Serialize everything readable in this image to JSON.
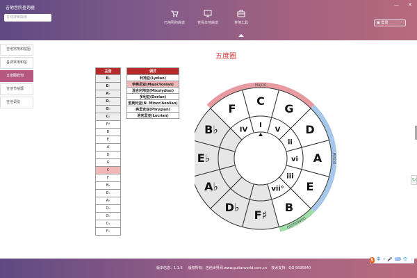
{
  "app": {
    "title": "吉他音阶查询器",
    "version": "版本信息：1.1.6",
    "copyright": "版权所有：吉他世界网 www.guitarworld.com.cn",
    "support": "技术支持：QQ 5695840"
  },
  "search": {
    "placeholder": "在线搜索曲谱"
  },
  "window_controls": {
    "minimize": "—",
    "close": "✕"
  },
  "nav": [
    {
      "label": "已拍照的曲谱",
      "icon": "cart-icon"
    },
    {
      "label": "查看本地曲谱",
      "icon": "monitor-icon"
    },
    {
      "label": "吉他工具",
      "icon": "toolbox-icon",
      "active": true
    }
  ],
  "login": {
    "label": "登录"
  },
  "sidebar": [
    {
      "label": "吉他常用和弦图"
    },
    {
      "label": "各调常用和弦"
    },
    {
      "label": "五度圈查询",
      "active": true
    },
    {
      "label": "吉他节拍器"
    },
    {
      "label": "吉他调弦"
    }
  ],
  "page": {
    "title": "五度圈"
  },
  "key_table": {
    "header": "主音",
    "keys": [
      "B♭",
      "E♭",
      "A♭",
      "D♭",
      "G♭",
      "C♭",
      "F♯",
      "B",
      "E",
      "A",
      "D",
      "G",
      "C",
      "F",
      "B♭",
      "E♭",
      "A♭",
      "D♭",
      "G♭",
      "C♭",
      "F♭"
    ],
    "selected": "C"
  },
  "mode_table": {
    "header": "调式",
    "modes": [
      "利地亚(Lydian)",
      "伊奥尼亚(Major/Ionian)",
      "混合利地亚(Mixolydian)",
      "多利亚(Dorian)",
      "爱奥利亚(N. Minor/Aeolian)",
      "弗里吉亚(Phrygian)",
      "洛克里亚(Locrian)"
    ],
    "selected": "伊奥尼亚(Major/Ionian)"
  },
  "circle": {
    "outer_keys": [
      "C",
      "G",
      "D",
      "A",
      "E",
      "B",
      "F♯",
      "D♭",
      "A♭",
      "E♭",
      "B♭",
      "F"
    ],
    "roman": [
      "I",
      "V",
      "ii",
      "vi",
      "iii",
      "vii°",
      "",
      "",
      "",
      "",
      "",
      "IV"
    ],
    "arcs": {
      "major": "MAJOR",
      "minor": "MINOR",
      "diminished": "DIMINISHED"
    },
    "colors": {
      "major": "#e79aa0",
      "minor": "#a7c7ea",
      "diminished": "#9fdda9",
      "shaded": "#e6e6e6"
    }
  },
  "tray": {
    "input_icon": "S",
    "input_label": "中",
    "items": [
      "•",
      "🎤",
      "⌨",
      "👕",
      "⋮"
    ]
  }
}
